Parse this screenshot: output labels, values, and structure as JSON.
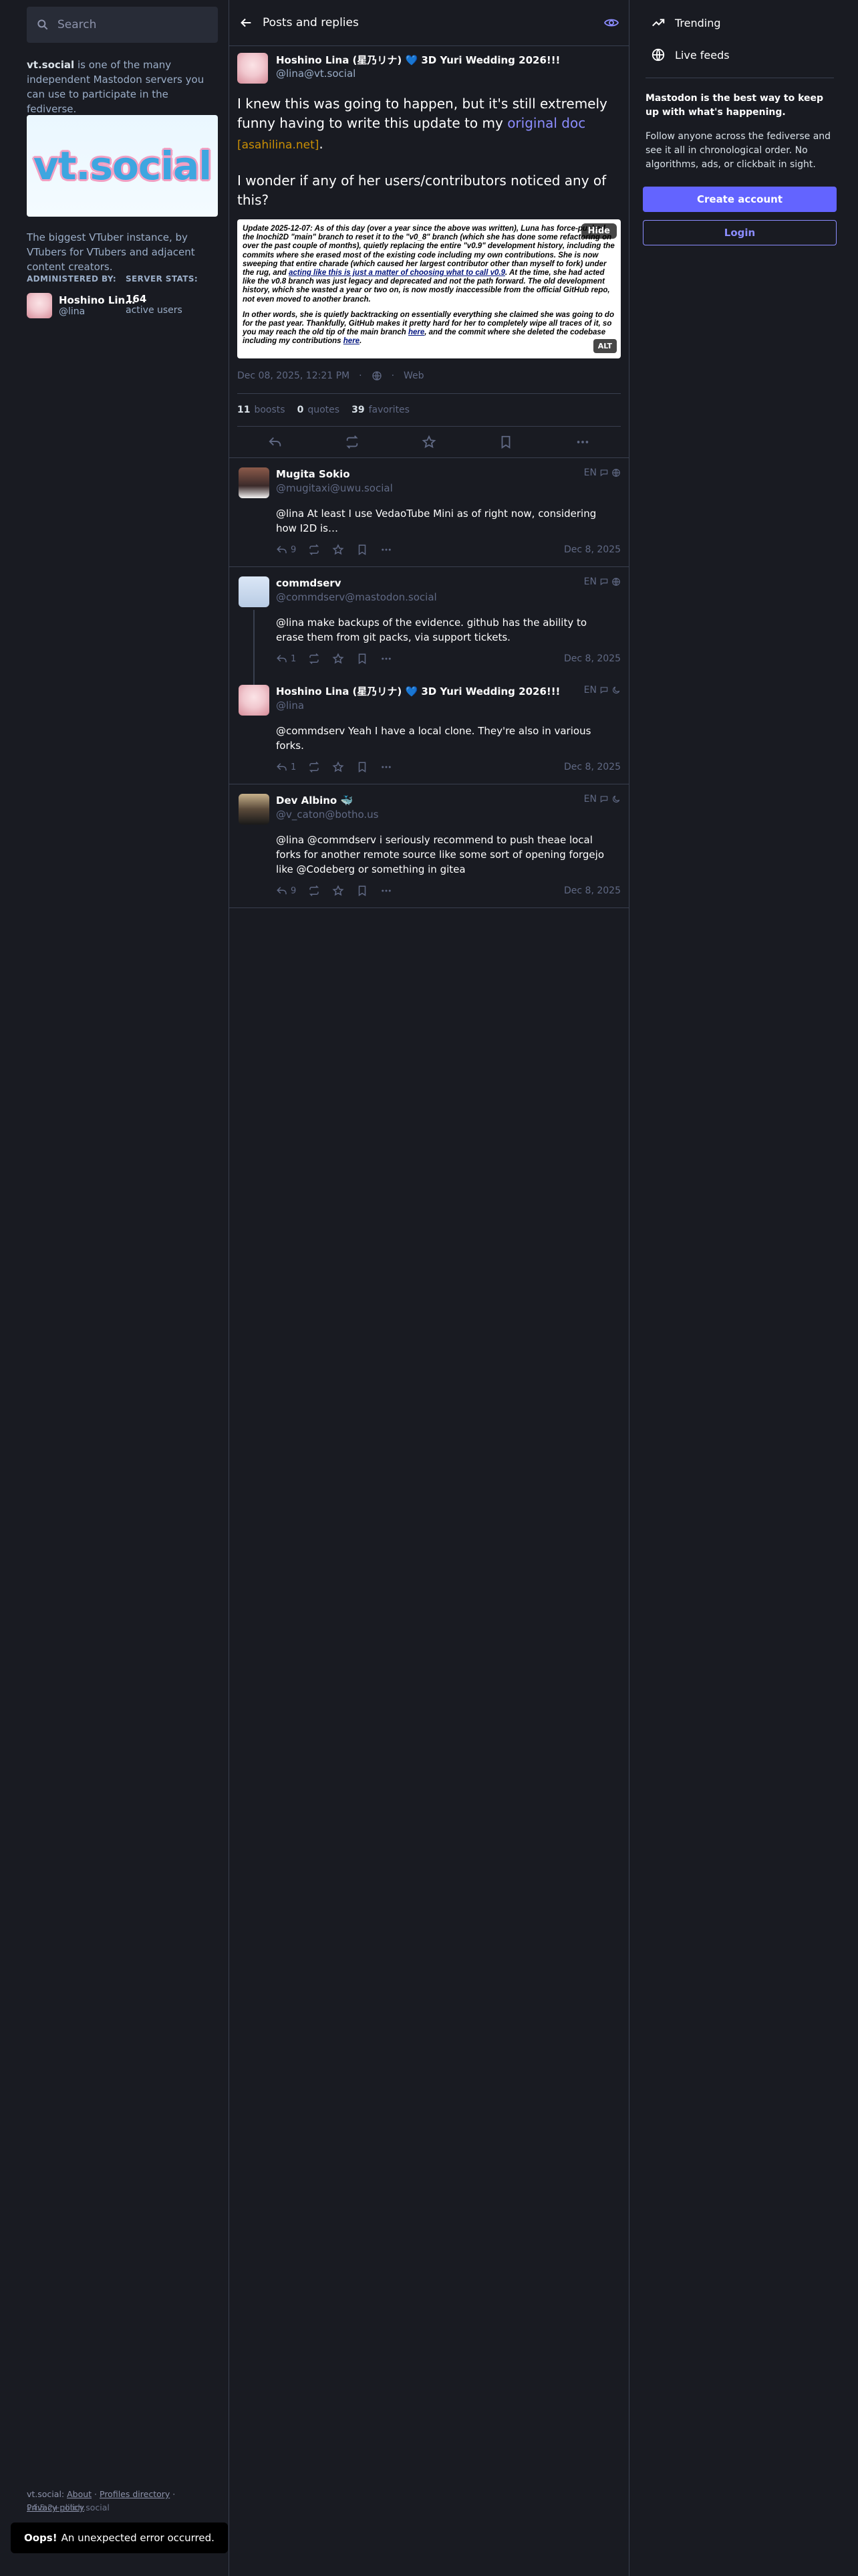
{
  "search": {
    "placeholder": "Search"
  },
  "server": {
    "name": "vt.social",
    "about_suffix": " is one of the many independent Mastodon servers you can use to participate in the fediverse.",
    "banner_text": "vt.social",
    "description": "The biggest VTuber instance, by VTubers for VTubers and adjacent content creators.",
    "administered_by_label": "ADMINISTERED BY:",
    "server_stats_label": "SERVER STATS:",
    "admin_name": "Hoshino Lin…",
    "admin_handle": "@lina",
    "active_users_count": "164",
    "active_users_label": "active users"
  },
  "footer": {
    "server": "vt.social",
    "links": [
      "About",
      "Profiles directory",
      "Privacy policy"
    ],
    "version": "v4.5.2+glitch.social"
  },
  "toast": {
    "title": "Oops!",
    "message": "An unexpected error occurred."
  },
  "column": {
    "title": "Posts and replies"
  },
  "status": {
    "display_name": "Hoshino Lina (星乃リナ) 💙 3D Yuri Wedding 2026!!!",
    "acct": "@lina@vt.social",
    "para1_before": "I knew this was going to happen, but it's still extremely funny having to write this update to my ",
    "para1_link": "original doc",
    "para1_domain": " [asahilina.net]",
    "para1_after": ".",
    "para2": "I wonder if any of her users/contributors noticed any of this?",
    "media": {
      "p1_a": "Update 2025-12-07: As of this day (over a year since the above was written), Luna has force-pushed the Inochi2D \"main\" branch to reset it to the \"v0_8\" branch (which she has done some refactoring on over the past couple of months), quietly replacing the entire \"v0.9\" development history, including the commits where she erased most of the existing code including my own contributions. She is now sweeping that entire charade (which caused her largest contributor other than myself to fork) under the rug, and ",
      "p1_link": "acting like this is just a matter of choosing what to call v0.9",
      "p1_b": ". At the time, she had acted like the v0.8 branch was just legacy and deprecated and not the path forward. The old development history, which she wasted a year or two on, is now mostly inaccessible from the official GitHub repo, not even moved to another branch.",
      "p2_a": "In other words, she is quietly backtracking on essentially everything she claimed she was going to do for the past year. Thankfully, GitHub makes it pretty hard for her to completely wipe all traces of it, so you may reach the old tip of the main branch ",
      "p2_link1": "here",
      "p2_b": ", and the commit where she deleted the codebase including my contributions ",
      "p2_link2": "here",
      "p2_c": ".",
      "hide_label": "Hide",
      "alt_label": "ALT"
    },
    "date": "Dec 08, 2025, 12:21 PM",
    "separator": "·",
    "app": "Web",
    "boosts_count": "11",
    "boosts_label": "boosts",
    "quotes_count": "0",
    "quotes_label": "quotes",
    "favorites_count": "39",
    "favorites_label": "favorites"
  },
  "replies": [
    {
      "name": "Mugita Sokio",
      "acct": "@mugitaxi@uwu.social",
      "lang": "EN",
      "text": "@lina At least I use VedaoTube Mini as of right now, considering how I2D is…",
      "reply_count": "9",
      "date": "Dec 8, 2025"
    },
    {
      "name": "commdserv",
      "acct": "@commdserv@mastodon.social",
      "lang": "EN",
      "text": "@lina make backups of the evidence. github has the ability to erase them from git packs, via support tickets.",
      "reply_count": "1",
      "date": "Dec 8, 2025"
    },
    {
      "name": "Hoshino Lina (星乃リナ) 💙 3D Yuri Wedding 2026!!!",
      "acct": "@lina",
      "lang": "EN",
      "text": "@commdserv Yeah I have a local clone. They're also in various forks.",
      "reply_count": "1",
      "date": "Dec 8, 2025"
    },
    {
      "name": "Dev Albino 🐳",
      "acct": "@v_caton@botho.us",
      "lang": "EN",
      "text": "@lina @commdserv i seriously recommend to push theae local forks for another remote source like some sort of opening forgejo like @Codeberg or something in gitea",
      "reply_count": "9",
      "date": "Dec 8, 2025"
    }
  ],
  "right_nav": {
    "trending": "Trending",
    "live_feeds": "Live feeds"
  },
  "signup": {
    "title": "Mastodon is the best way to keep up with what's happening.",
    "text": "Follow anyone across the fediverse and see it all in chronological order. No algorithms, ads, or clickbait in sight.",
    "create_account": "Create account",
    "login": "Login"
  },
  "colors": {
    "accent": "#6364ff",
    "link": "#8c8dff",
    "background": "#191b22",
    "surface": "#282c37"
  },
  "icons": [
    "search-icon",
    "back-arrow-icon",
    "eye-icon",
    "globe-icon",
    "reply-icon",
    "boost-icon",
    "star-icon",
    "bookmark-icon",
    "more-icon",
    "trending-icon",
    "reply-all-icon",
    "quote-icon",
    "lock-icon"
  ]
}
